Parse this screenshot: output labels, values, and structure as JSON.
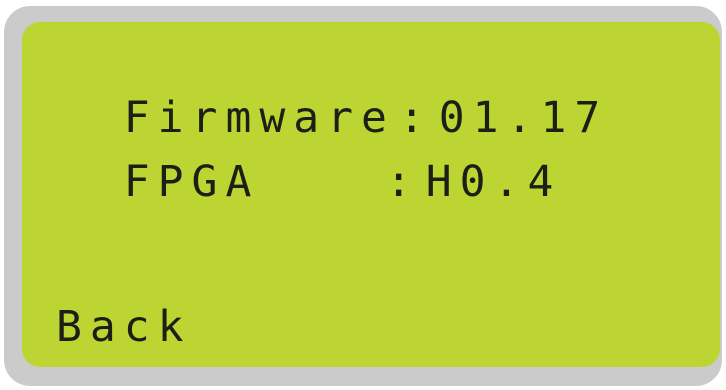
{
  "display": {
    "rows": [
      {
        "label": "Firmware",
        "separator": ":",
        "value": "01.17"
      },
      {
        "label": "FPGA",
        "separator": ":",
        "value": "H0.4"
      }
    ],
    "back_label": "Back"
  },
  "colors": {
    "bezel": "#cbcbcb",
    "screen": "#bcd532",
    "text": "#1c1f16"
  }
}
